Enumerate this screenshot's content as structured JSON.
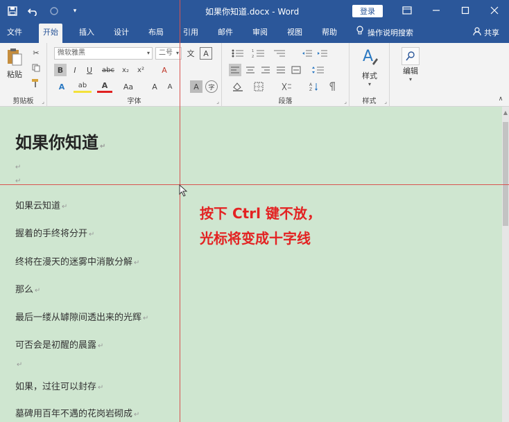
{
  "window": {
    "title": "如果你知道.docx - Word",
    "login_label": "登录"
  },
  "tabs": [
    {
      "label": "文件"
    },
    {
      "label": "开始"
    },
    {
      "label": "插入"
    },
    {
      "label": "设计"
    },
    {
      "label": "布局"
    },
    {
      "label": "引用"
    },
    {
      "label": "邮件"
    },
    {
      "label": "审阅"
    },
    {
      "label": "视图"
    },
    {
      "label": "帮助"
    }
  ],
  "tell_me": "操作说明搜索",
  "share": "共享",
  "ribbon": {
    "clipboard": {
      "label": "剪贴板",
      "paste_label": "粘贴"
    },
    "font": {
      "label": "字体",
      "font_name": "微软雅黑",
      "font_size": "二号",
      "bold": "B",
      "italic": "I",
      "underline": "U",
      "strike": "abc",
      "subscript": "x₂",
      "superscript": "x²",
      "clear": "A",
      "phonetic": "文",
      "border_char": "A",
      "text_effect": "A",
      "highlight": "ab",
      "font_color": "A",
      "case": "Aa",
      "grow": "A",
      "shrink": "A",
      "shade": "A",
      "enclose": "字"
    },
    "paragraph": {
      "label": "段落"
    },
    "styles": {
      "label": "样式",
      "button": "样式"
    },
    "editing": {
      "button": "编辑"
    }
  },
  "document": {
    "heading": "如果你知道",
    "lines": [
      "如果云知道",
      "握着的手终将分开",
      "终将在漫天的迷雾中消散分解",
      "那么",
      "最后一缕从罅隙间透出来的光辉",
      "可否会是初醒的晨露",
      "",
      "如果，过往可以封存",
      "墓碑用百年不遇的花岗岩砌成"
    ]
  },
  "annotation": {
    "line1": "按下 Ctrl 键不放，",
    "line2": "光标将变成十字线"
  },
  "colors": {
    "word_blue": "#2b579a",
    "doc_bg": "#cfe6d0",
    "annotation_red": "#e32222",
    "crosshair": "#d9534f"
  }
}
